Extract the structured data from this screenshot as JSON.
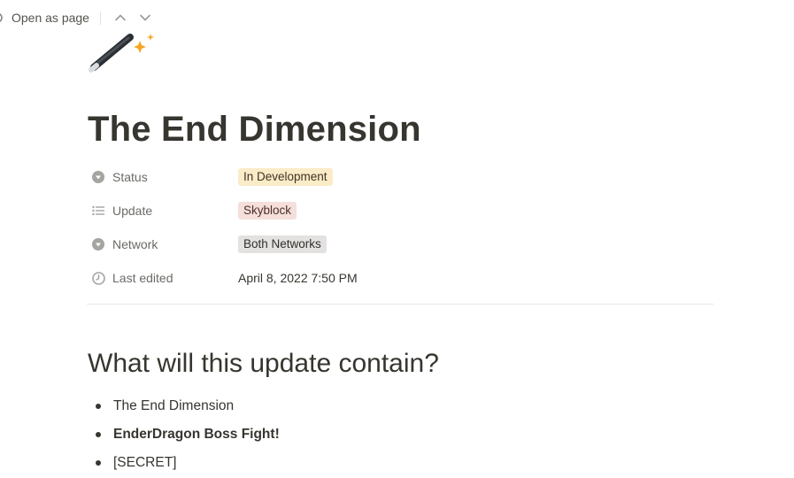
{
  "topbar": {
    "open_as_page": "Open as page"
  },
  "page": {
    "icon": "magic-wand-icon",
    "title": "The End Dimension"
  },
  "properties": [
    {
      "name": "status",
      "label": "Status",
      "icon": "select-icon",
      "value": "In Development",
      "tag_bg": "#fbecc8",
      "tag_fg": "#3f3423"
    },
    {
      "name": "update",
      "label": "Update",
      "icon": "list-icon",
      "value": "Skyblock",
      "tag_bg": "#f4dfdb",
      "tag_fg": "#4f2f28"
    },
    {
      "name": "network",
      "label": "Network",
      "icon": "select-icon",
      "value": "Both Networks",
      "tag_bg": "#e3e2e0",
      "tag_fg": "#32302c"
    },
    {
      "name": "last-edited",
      "label": "Last edited",
      "icon": "clock-icon",
      "value": "April 8, 2022 7:50 PM"
    }
  ],
  "content": {
    "heading": "What will this update contain?",
    "bullets": [
      {
        "text": "The End Dimension",
        "bold": false
      },
      {
        "text": "EnderDragon Boss Fight!",
        "bold": true
      },
      {
        "text": "[SECRET]",
        "bold": false
      }
    ]
  }
}
